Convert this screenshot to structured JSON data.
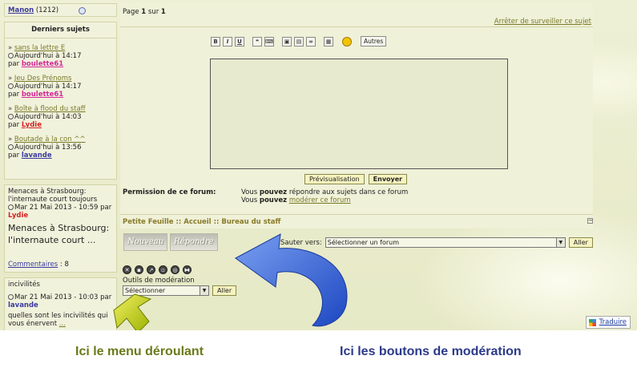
{
  "sidebar": {
    "online": {
      "user": "Manon",
      "count": "(1212)"
    },
    "recent": {
      "title": "Derniers sujets",
      "items": [
        {
          "topic": "sans la lettre E",
          "time": "Aujourd'hui à 14:17",
          "by": "par",
          "author": "boulette61",
          "author_color": "#d42a9a"
        },
        {
          "topic": "Jeu Des Prénoms",
          "time": "Aujourd'hui à 14:17",
          "by": "par",
          "author": "boulette61",
          "author_color": "#d42a9a"
        },
        {
          "topic": "Boîte à flood du staff",
          "time": "Aujourd'hui à 14:03",
          "by": "par",
          "author": "Lydie",
          "author_color": "#d42222"
        },
        {
          "topic": "Boutade à la con ^^",
          "time": "Aujourd'hui à 13:56",
          "by": "par",
          "author": "lavande",
          "author_color": "#3a3aa0"
        }
      ]
    },
    "news": {
      "title": "Menaces à Strasbourg: l'internaute court toujours",
      "time": "Mar 21 Mai 2013 - 10:59 par",
      "author": "Lydie",
      "excerpt": "Menaces à Strasbourg: l'internaute court ...",
      "comments_label": "Commentaires",
      "comments_count": ": 8"
    },
    "incivil": {
      "title": "incivilités",
      "time": "Mar 21 Mai 2013 - 10:03 par",
      "author": "lavande",
      "excerpt_a": "quelles sont les incivilités qui",
      "excerpt_b": "vous énervent",
      "ellipsis": "..."
    }
  },
  "main": {
    "page_prefix": "Page",
    "page_current": "1",
    "page_sep": "sur",
    "page_total": "1",
    "stop_watching": "Arrêter de surveiller ce sujet",
    "toolbar": {
      "bold": "B",
      "italic": "I",
      "underline": "U",
      "autres": "Autres"
    },
    "buttons": {
      "preview": "Prévisualisation",
      "send": "Envoyer"
    },
    "permission": {
      "label": "Permission de ce forum:",
      "line1_a": "Vous",
      "line1_b": "pouvez",
      "line1_c": "répondre aux sujets dans ce forum",
      "line2_a": "Vous",
      "line2_b": "pouvez",
      "line2_link": "modérer ce forum"
    },
    "breadcrumb": {
      "a": "Petite Feuille",
      "sep": "::",
      "b": "Accueil",
      "c": "Bureau du staff"
    }
  },
  "bottom": {
    "new_btn": "Nouveau",
    "reply_btn": "Répondre",
    "jump_label": "Sauter vers:",
    "jump_value": "Sélectionner un forum",
    "go": "Aller",
    "mod_label": "Outils de modération",
    "mod_value": "Sélectionner",
    "mod_go": "Aller",
    "translate": "Traduire"
  },
  "captions": {
    "left": "Ici le menu déroulant",
    "right": "Ici les boutons  de modération"
  },
  "colors": {
    "arrow_blue": "#2f5fd6",
    "arrow_yellow": "#d8e000",
    "caption_left": "#6a7a1a",
    "caption_right": "#2b3a8a"
  }
}
